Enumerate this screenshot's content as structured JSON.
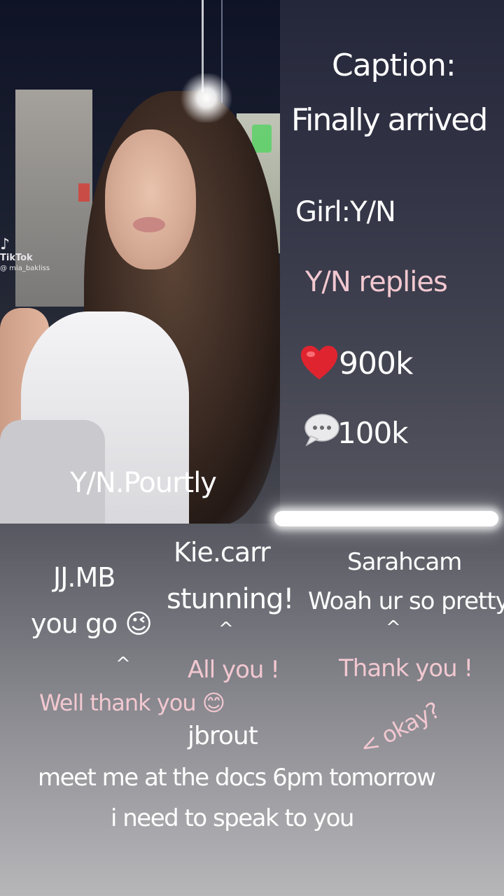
{
  "photo": {
    "tiktok_logo": "TikTok",
    "watermark_user": "@ mia_bakliss",
    "username": "Y/N.Pourtly"
  },
  "post": {
    "caption_label": "Caption:",
    "caption_text": "Finally arrived",
    "girl_label": "Girl:Y/N",
    "replies_label": "Y/N replies",
    "likes": "900k",
    "comments": "100k"
  },
  "comments": [
    {
      "user": "JJ.MB",
      "text": "you go 😉",
      "caret": "^",
      "reply": "Well thank you 😊"
    },
    {
      "user": "Kie.carr",
      "text": "stunning!",
      "caret": "^",
      "reply": "All you !"
    },
    {
      "user": "Sarahcam",
      "text": "Woah ur so pretty!",
      "caret": "^",
      "reply": "Thank you !"
    },
    {
      "user": "jbrout",
      "text_line1": "meet me at the docs 6pm tomorrow",
      "text_line2": "i need to speak to you",
      "reply": "< okay?"
    }
  ],
  "colors": {
    "text": "#ffffff",
    "reply": "#f2c8d0",
    "heart": "#e0242f"
  },
  "icons": [
    "heart-icon",
    "speech-bubble-icon"
  ]
}
